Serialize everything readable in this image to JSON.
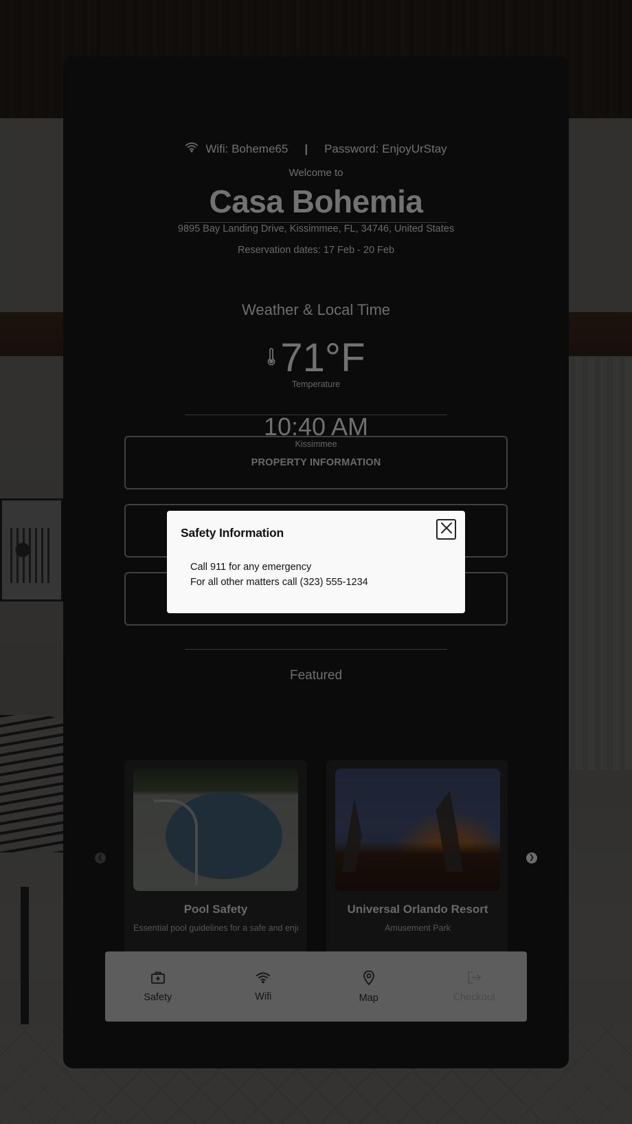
{
  "header": {
    "wifi_label": "Wifi: Boheme65",
    "separator": "|",
    "password_label": "Password: EnjoyUrStay",
    "welcome": "Welcome to",
    "property_name": "Casa Bohemia",
    "address": "9895 Bay Landing Drive, Kissimmee, FL, 34746, United States",
    "reservation": "Reservation dates: 17 Feb - 20 Feb"
  },
  "weather": {
    "section_title": "Weather & Local Time",
    "temperature": "71°F",
    "temperature_label": "Temperature",
    "time": "10:40 AM",
    "time_label": "Kissimmee"
  },
  "buttons": {
    "property_information": "PROPERTY INFORMATION"
  },
  "featured": {
    "section_title": "Featured",
    "items": [
      {
        "title": "Pool Safety",
        "subtitle": "Essential pool guidelines for a safe and enjoyable experience"
      },
      {
        "title": "Universal Orlando Resort",
        "subtitle": "Amusement Park"
      }
    ]
  },
  "navbar": {
    "items": [
      {
        "label": "Safety",
        "icon": "first-aid-kit-icon"
      },
      {
        "label": "Wifi",
        "icon": "wifi-icon"
      },
      {
        "label": "Map",
        "icon": "map-pin-icon"
      },
      {
        "label": "Checkout",
        "icon": "logout-icon"
      }
    ]
  },
  "modal": {
    "title": "Safety Information",
    "line1": "Call 911 for any emergency",
    "line2": "For all other matters call (323) 555-1234"
  },
  "colors": {
    "card_bg": "#0b0b0b",
    "overlay": "rgba(8,8,8,0.80)",
    "modal_bg": "#f9f9f9",
    "navbar_bg": "#5d5d5d"
  }
}
